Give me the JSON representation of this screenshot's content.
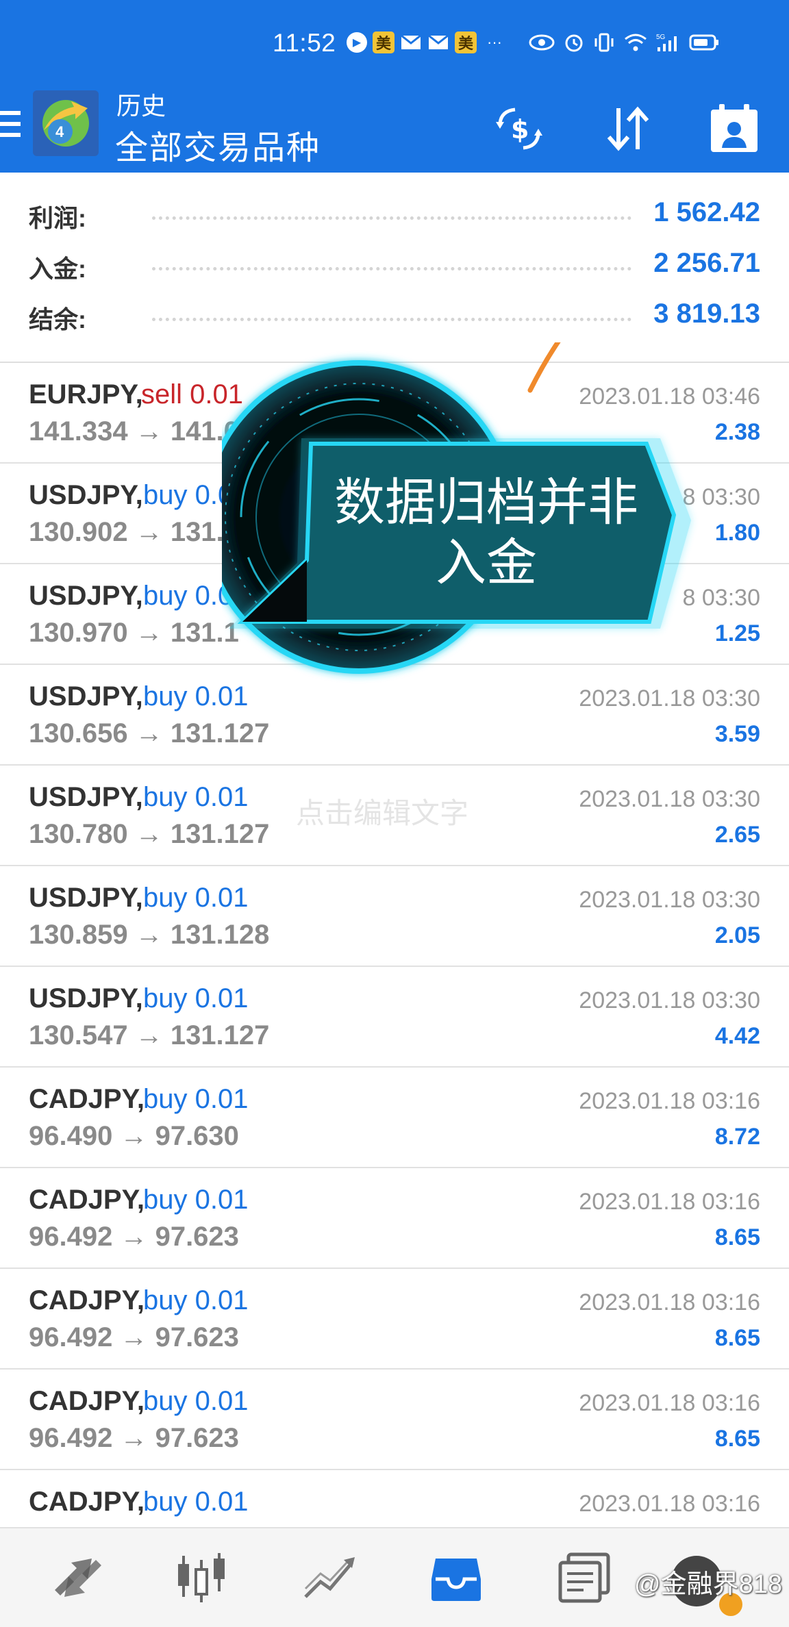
{
  "status_bar": {
    "time": "11:52",
    "notification_icons": [
      "play-icon",
      "meituan-icon",
      "mail-icon",
      "mail-icon",
      "meituan-icon",
      "more-icon"
    ],
    "mei_label": "美",
    "more_label": "···",
    "system_icons": [
      "eye-icon",
      "alarm-icon",
      "vibrate-icon",
      "wifi-icon",
      "signal-5g-icon",
      "battery-icon"
    ]
  },
  "toolbar": {
    "subtitle": "历史",
    "title": "全部交易品种",
    "colors": {
      "primary": "#1a74e2"
    }
  },
  "summary": {
    "rows": [
      {
        "label": "利润:",
        "value": "1 562.42"
      },
      {
        "label": "入金:",
        "value": "2 256.71"
      },
      {
        "label": "结余:",
        "value": "3 819.13"
      }
    ]
  },
  "deals": [
    {
      "symbol": "EURJPY,",
      "side": "sell 0.01",
      "side_type": "sell",
      "prices": "141.334 → 141.02",
      "time": "2023.01.18 03:46",
      "profit": "2.38"
    },
    {
      "symbol": "USDJPY,",
      "side": "buy 0.0",
      "side_type": "buy",
      "prices": "130.902 → 131.",
      "time": "8 03:30",
      "profit": "1.80"
    },
    {
      "symbol": "USDJPY,",
      "side": "buy 0.01",
      "side_type": "buy",
      "prices": "130.970 → 131.1",
      "time": "8 03:30",
      "profit": "1.25"
    },
    {
      "symbol": "USDJPY,",
      "side": "buy 0.01",
      "side_type": "buy",
      "prices": "130.656 → 131.127",
      "time": "2023.01.18 03:30",
      "profit": "3.59"
    },
    {
      "symbol": "USDJPY,",
      "side": "buy 0.01",
      "side_type": "buy",
      "prices": "130.780 → 131.127",
      "time": "2023.01.18 03:30",
      "profit": "2.65"
    },
    {
      "symbol": "USDJPY,",
      "side": "buy 0.01",
      "side_type": "buy",
      "prices": "130.859 → 131.128",
      "time": "2023.01.18 03:30",
      "profit": "2.05"
    },
    {
      "symbol": "USDJPY,",
      "side": "buy 0.01",
      "side_type": "buy",
      "prices": "130.547 → 131.127",
      "time": "2023.01.18 03:30",
      "profit": "4.42"
    },
    {
      "symbol": "CADJPY,",
      "side": "buy 0.01",
      "side_type": "buy",
      "prices": "96.490 → 97.630",
      "time": "2023.01.18 03:16",
      "profit": "8.72"
    },
    {
      "symbol": "CADJPY,",
      "side": "buy 0.01",
      "side_type": "buy",
      "prices": "96.492 → 97.623",
      "time": "2023.01.18 03:16",
      "profit": "8.65"
    },
    {
      "symbol": "CADJPY,",
      "side": "buy 0.01",
      "side_type": "buy",
      "prices": "96.492 → 97.623",
      "time": "2023.01.18 03:16",
      "profit": "8.65"
    },
    {
      "symbol": "CADJPY,",
      "side": "buy 0.01",
      "side_type": "buy",
      "prices": "96.492 → 97.623",
      "time": "2023.01.18 03:16",
      "profit": "8.65"
    },
    {
      "symbol": "CADJPY,",
      "side": "buy 0.01",
      "side_type": "buy",
      "prices": "",
      "time": "2023.01.18 03:16",
      "profit": ""
    }
  ],
  "overlay": {
    "line1": "数据归档并非",
    "line2": "入金",
    "edit_hint": "点击编辑文字",
    "colors": {
      "glow": "#27d7f5",
      "panel": "#0f5e6a",
      "arrow": "#f08a2c"
    }
  },
  "bottom_nav": {
    "items": [
      "quotes-icon",
      "chart-icon",
      "trade-icon",
      "history-icon",
      "messages-icon"
    ],
    "active": "history-icon",
    "watermark": "@金融界818"
  }
}
